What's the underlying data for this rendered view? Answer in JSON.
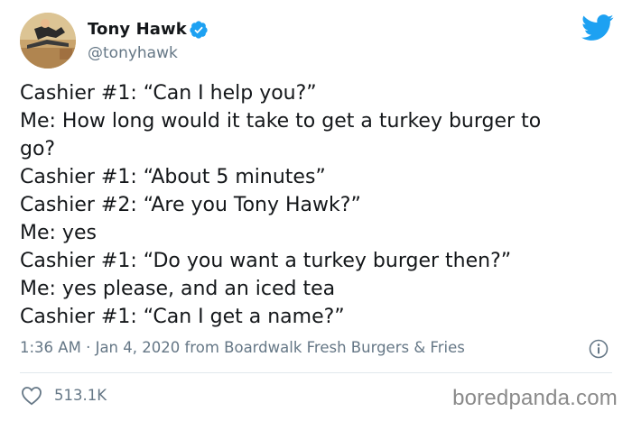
{
  "author": {
    "name": "Tony Hawk",
    "handle": "@tonyhawk",
    "avatar": "avatar-photo",
    "verified_icon": "verified-badge-icon"
  },
  "platform_icon": "twitter-bird-icon",
  "tweet_lines": [
    "Cashier #1: “Can I help you?”",
    "Me: How long would it take to get a turkey burger to",
    "go?",
    "Cashier #1: “About 5 minutes”",
    "Cashier #2: “Are you Tony Hawk?”",
    "Me: yes",
    "Cashier #1: “Do you want a turkey burger then?”",
    "Me: yes please, and an iced tea",
    "Cashier #1: “Can I get a name?”"
  ],
  "meta": {
    "time": "1:36 AM",
    "separator": "·",
    "date": "Jan 4, 2020",
    "source_prefix": "from",
    "source": "Boardwalk Fresh Burgers & Fries",
    "info_icon": "info-icon"
  },
  "engagement": {
    "likes": "513.1K",
    "heart_icon": "heart-icon"
  },
  "watermark": "boredpanda.com",
  "colors": {
    "text": "#14171a",
    "secondary": "#657786",
    "brand_blue": "#1da1f2",
    "divider": "#e1e8ed"
  }
}
